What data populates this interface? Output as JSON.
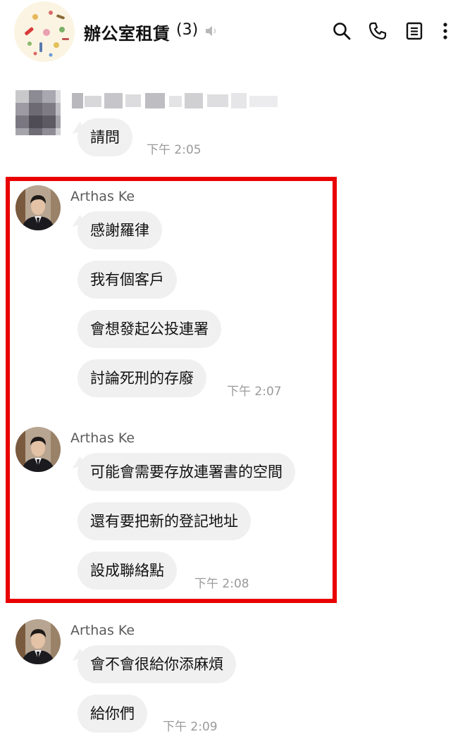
{
  "header": {
    "title": "辦公室租賃",
    "member_count": "(3)",
    "icons": [
      "speaker-muted-icon",
      "search-icon",
      "phone-icon",
      "notes-icon",
      "more-vertical-icon"
    ]
  },
  "messages": [
    {
      "sender": "",
      "text": "請問",
      "time": "下午 2:05"
    },
    {
      "sender": "Arthas Ke",
      "lines": [
        "感謝羅律",
        "我有個客戶",
        "會想發起公投連署",
        "討論死刑的存廢"
      ],
      "time": "下午 2:07"
    },
    {
      "sender": "Arthas Ke",
      "lines": [
        "可能會需要存放連署書的空間",
        "還有要把新的登記地址",
        "設成聯絡點"
      ],
      "time": "下午 2:08"
    },
    {
      "sender": "Arthas Ke",
      "lines": [
        "會不會很給你添麻煩",
        "給你們"
      ],
      "time": "下午 2:09"
    }
  ],
  "colors": {
    "highlight": "#e90000",
    "bubble": "#f0f0f0",
    "time": "#9a9a9a",
    "sender": "#5a5a5a"
  }
}
